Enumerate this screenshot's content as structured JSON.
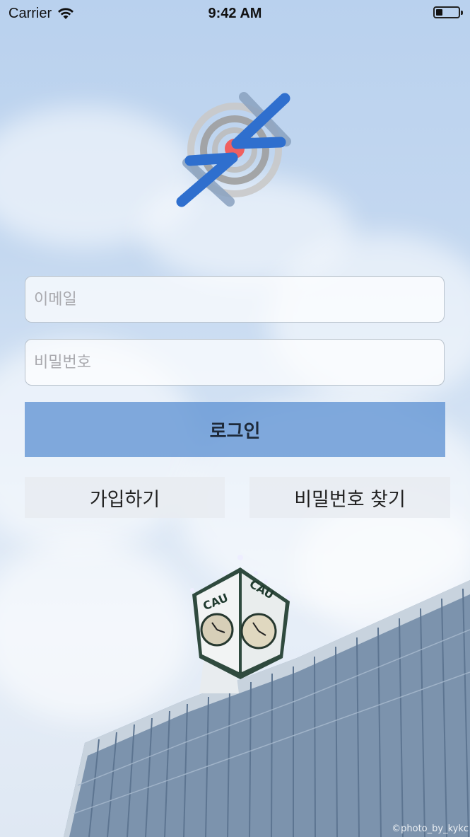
{
  "status_bar": {
    "carrier": "Carrier",
    "time": "9:42 AM",
    "battery_level": 0.25
  },
  "logo": {
    "icon": "target-cross-logo-icon",
    "accent": "#2f6fce",
    "center": "#f06060"
  },
  "form": {
    "email_placeholder": "이메일",
    "password_placeholder": "비밀번호",
    "login_label": "로그인"
  },
  "actions": {
    "signup_label": "가입하기",
    "find_password_label": "비밀번호 찾기"
  },
  "photo_credit": "©photo_by_kykc",
  "clock_tower_sign": "CAU",
  "colors": {
    "login_button": "#6094d4",
    "sky": "#c4d8f0"
  }
}
